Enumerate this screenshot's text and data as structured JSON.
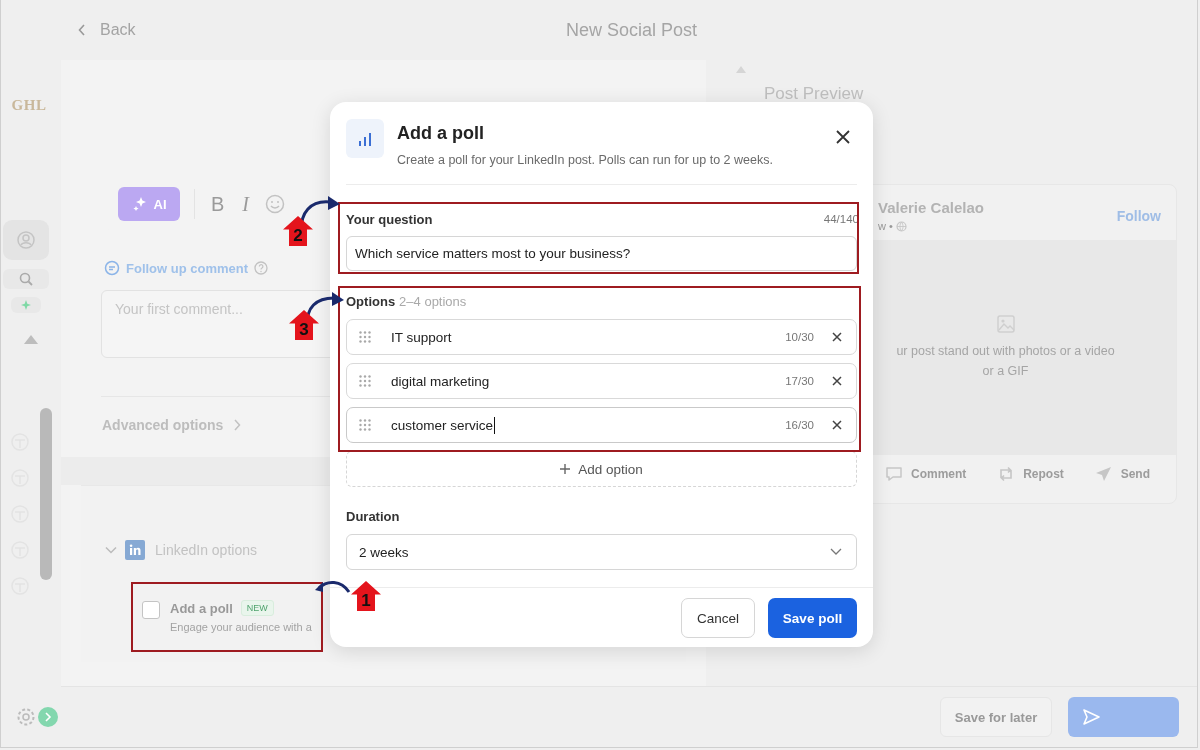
{
  "header": {
    "back_label": "Back",
    "title": "New Social Post"
  },
  "sidebar": {
    "logo": "GHL"
  },
  "editor": {
    "ai_label": "AI",
    "toolbar": [
      {
        "kind": "text",
        "label": "B"
      },
      {
        "kind": "text",
        "label": "I"
      },
      {
        "kind": "emoji"
      }
    ]
  },
  "follow_up": {
    "label": "Follow up comment",
    "placeholder": "Your first comment..."
  },
  "advanced_options": {
    "label": "Advanced options"
  },
  "linkedin_options": {
    "label": "LinkedIn options",
    "expanded": true,
    "poll": {
      "label": "Add a poll",
      "badge": "NEW",
      "description": "Engage your audience with a",
      "checked": false
    }
  },
  "preview": {
    "title": "Post Preview",
    "author": "Valerie Calelao",
    "meta": "w •",
    "follow": "Follow",
    "placeholder_lines": [
      "ur post stand out with photos or a video",
      "or a GIF"
    ],
    "actions": [
      {
        "kind": "comment",
        "label": "Comment"
      },
      {
        "kind": "repost",
        "label": "Repost"
      },
      {
        "kind": "send",
        "label": "Send"
      }
    ]
  },
  "footer": {
    "save_later": "Save for later"
  },
  "modal": {
    "title": "Add a poll",
    "subtitle": "Create a poll for your LinkedIn post. Polls can run for up to 2 weeks.",
    "question_label": "Your question",
    "question_count": "44/140",
    "question": "Which service matters most to your business?",
    "options_label": "Options",
    "options_hint": "2–4 options",
    "options": [
      {
        "text": "IT support",
        "count": "10/30",
        "focused": false
      },
      {
        "text": "digital marketing",
        "count": "17/30",
        "focused": false
      },
      {
        "text": "customer service",
        "count": "16/30",
        "focused": true
      }
    ],
    "add_option": "Add option",
    "duration_label": "Duration",
    "duration": "2 weeks",
    "cancel": "Cancel",
    "save": "Save poll"
  },
  "annotations": [
    {
      "number": "1"
    },
    {
      "number": "2"
    },
    {
      "number": "3"
    }
  ]
}
